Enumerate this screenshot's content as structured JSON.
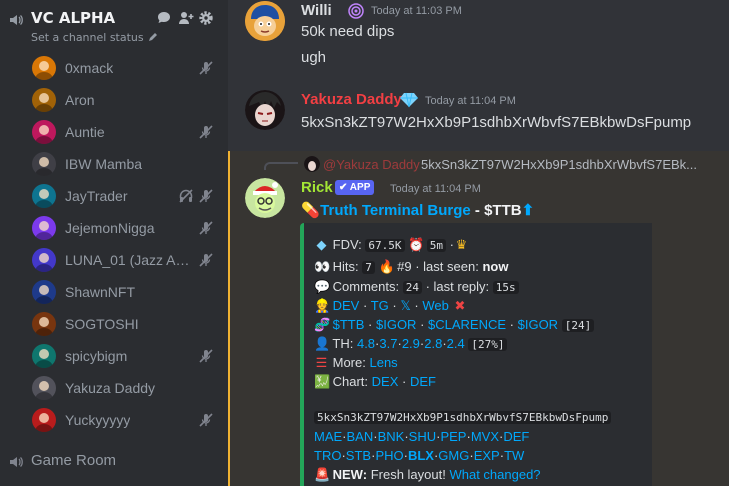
{
  "channel": {
    "name": "VC ALPHA",
    "status": "Set a channel status"
  },
  "members": [
    {
      "name": "0xmack",
      "muted": true,
      "deafened": false
    },
    {
      "name": "Aron",
      "muted": false,
      "deafened": false
    },
    {
      "name": "Auntie",
      "muted": true,
      "deafened": false
    },
    {
      "name": "IBW Mamba",
      "muted": false,
      "deafened": false
    },
    {
      "name": "JayTrader",
      "muted": true,
      "deafened": true
    },
    {
      "name": "JejemonNigga",
      "muted": true,
      "deafened": false
    },
    {
      "name": "LUNA_01 (Jazz Asi...",
      "muted": true,
      "deafened": false
    },
    {
      "name": "ShawnNFT",
      "muted": false,
      "deafened": false
    },
    {
      "name": "SOGTOSHI",
      "muted": false,
      "deafened": false
    },
    {
      "name": "spicybigm",
      "muted": true,
      "deafened": false
    },
    {
      "name": "Yakuza Daddy",
      "muted": false,
      "deafened": false
    },
    {
      "name": "Yuckyyyyy",
      "muted": true,
      "deafened": false
    }
  ],
  "other_channel": "Game Room",
  "messages": [
    {
      "author": "Willi",
      "time": "Today at 11:03 PM",
      "lines": [
        "50k need dips",
        "ugh"
      ]
    },
    {
      "author": "Yakuza Daddy",
      "time": "Today at 11:04 PM",
      "lines": [
        "5kxSn3kZT97W2HxXb9P1sdhbXrWbvfS7EBkbwDsFpump"
      ]
    }
  ],
  "reply": {
    "author": "@Yakuza Daddy",
    "text": "5kxSn3kZT97W2HxXb9P1sdhbXrWbvfS7EBk..."
  },
  "bot_message": {
    "author": "Rick",
    "badge": "APP",
    "time": "Today at 11:04 PM",
    "title": "Truth Terminal Burge",
    "ticker": "- $TTB",
    "embed": {
      "fdv_label": "FDV:",
      "fdv": "67.5K",
      "age": "5m",
      "hits_label": "Hits:",
      "hits": "7",
      "rank": "#9",
      "last_seen_label": "· last seen:",
      "last_seen": "now",
      "comments_label": "Comments:",
      "comments": "24",
      "last_reply_label": "· last reply:",
      "last_reply": "15s",
      "links": [
        "DEV",
        "TG",
        "𝕏",
        "Web"
      ],
      "tickers": [
        "$TTB",
        "$IGOR",
        "$CLARENCE",
        "$IGOR"
      ],
      "tickers_count": "[24]",
      "th_label": "TH:",
      "th": [
        "4.8",
        "3.7",
        "2.9",
        "2.8",
        "2.4"
      ],
      "th_total": "[27%]",
      "more_label": "More:",
      "more": "Lens",
      "chart_label": "Chart:",
      "chart": [
        "DEX",
        "DEF"
      ],
      "contract": "5kxSn3kZT97W2HxXb9P1sdhbXrWbvfS7EBkbwDsFpump",
      "row1": [
        "MAE",
        "BAN",
        "BNK",
        "SHU",
        "PEP",
        "MVX",
        "DEF"
      ],
      "row2": [
        "TRO",
        "STB",
        "PHO",
        "BLX",
        "GMG",
        "EXP",
        "TW"
      ],
      "new_label": "NEW:",
      "new_text": "Fresh layout!",
      "new_link": "What changed?"
    }
  },
  "colors": {
    "sidebar_bg": "#2b2d31",
    "chat_bg": "#313338",
    "highlight_bg": "#373532",
    "highlight_bar": "#f0b232",
    "link": "#00a8fc",
    "yakuza_name": "#f23f43",
    "rick_name": "#a3e635",
    "embed_border": "#23a559",
    "app_badge": "#5865f2"
  }
}
